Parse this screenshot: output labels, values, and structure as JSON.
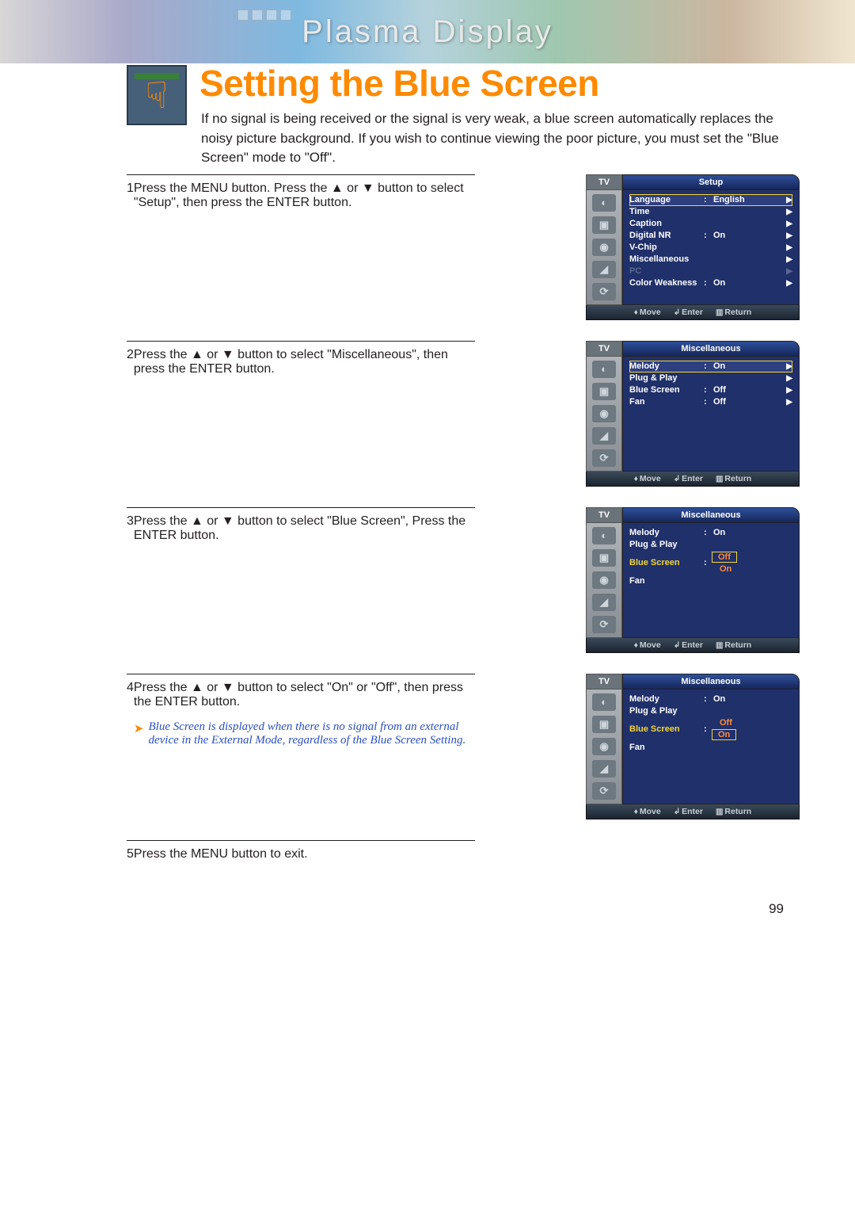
{
  "banner_text": "Plasma Display",
  "title": "Setting the Blue Screen",
  "intro": "If no signal is being received or the signal is very weak, a blue screen automatically replaces the noisy picture background. If you wish to continue viewing the poor picture, you must set the \"Blue Screen\" mode to \"Off\".",
  "steps": [
    {
      "num": "1",
      "text": "Press the MENU button. Press the ▲ or ▼ button to select \"Setup\", then press the ENTER button."
    },
    {
      "num": "2",
      "text": "Press the ▲ or ▼ button to select \"Miscellaneous\", then press the ENTER button."
    },
    {
      "num": "3",
      "text": "Press the ▲ or ▼ button to select \"Blue Screen\", Press the ENTER button."
    },
    {
      "num": "4",
      "text": "Press the ▲ or ▼ button to select \"On\" or \"Off\", then press the ENTER button.",
      "note": "Blue Screen is displayed when there is no signal from an external device in the External Mode, regardless of the Blue Screen Setting."
    },
    {
      "num": "5",
      "text": "Press the MENU button to exit."
    }
  ],
  "tv_label": "TV",
  "footer": {
    "move": "Move",
    "enter": "Enter",
    "ret": "Return"
  },
  "menus": [
    {
      "title": "Setup",
      "rows": [
        {
          "lbl": "Language",
          "val": "English",
          "sel": true,
          "ar": true
        },
        {
          "lbl": "Time",
          "ar": true
        },
        {
          "lbl": "Caption",
          "ar": true
        },
        {
          "lbl": "Digital NR",
          "val": "On",
          "ar": true
        },
        {
          "lbl": "V-Chip",
          "ar": true
        },
        {
          "lbl": "Miscellaneous",
          "ar": true
        },
        {
          "lbl": "PC",
          "dis": true,
          "ar": true
        },
        {
          "lbl": "Color Weakness",
          "val": "On",
          "ar": true
        }
      ]
    },
    {
      "title": "Miscellaneous",
      "rows": [
        {
          "lbl": "Melody",
          "val": "On",
          "sel": true,
          "ar": true
        },
        {
          "lbl": "Plug & Play",
          "ar": true
        },
        {
          "lbl": "Blue Screen",
          "val": "Off",
          "ar": true
        },
        {
          "lbl": "Fan",
          "val": "Off",
          "ar": true
        }
      ]
    },
    {
      "title": "Miscellaneous",
      "rows": [
        {
          "lbl": "Melody",
          "val": "On"
        },
        {
          "lbl": "Plug & Play"
        },
        {
          "lbl": "Blue Screen",
          "hi": true,
          "opt": [
            "Off",
            "On"
          ],
          "optsel": 0
        },
        {
          "lbl": "Fan"
        }
      ]
    },
    {
      "title": "Miscellaneous",
      "rows": [
        {
          "lbl": "Melody",
          "val": "On"
        },
        {
          "lbl": "Plug & Play"
        },
        {
          "lbl": "Blue Screen",
          "hi": true,
          "opt": [
            "Off",
            "On"
          ],
          "optsel": 1
        },
        {
          "lbl": "Fan"
        }
      ]
    }
  ],
  "page_number": "99"
}
